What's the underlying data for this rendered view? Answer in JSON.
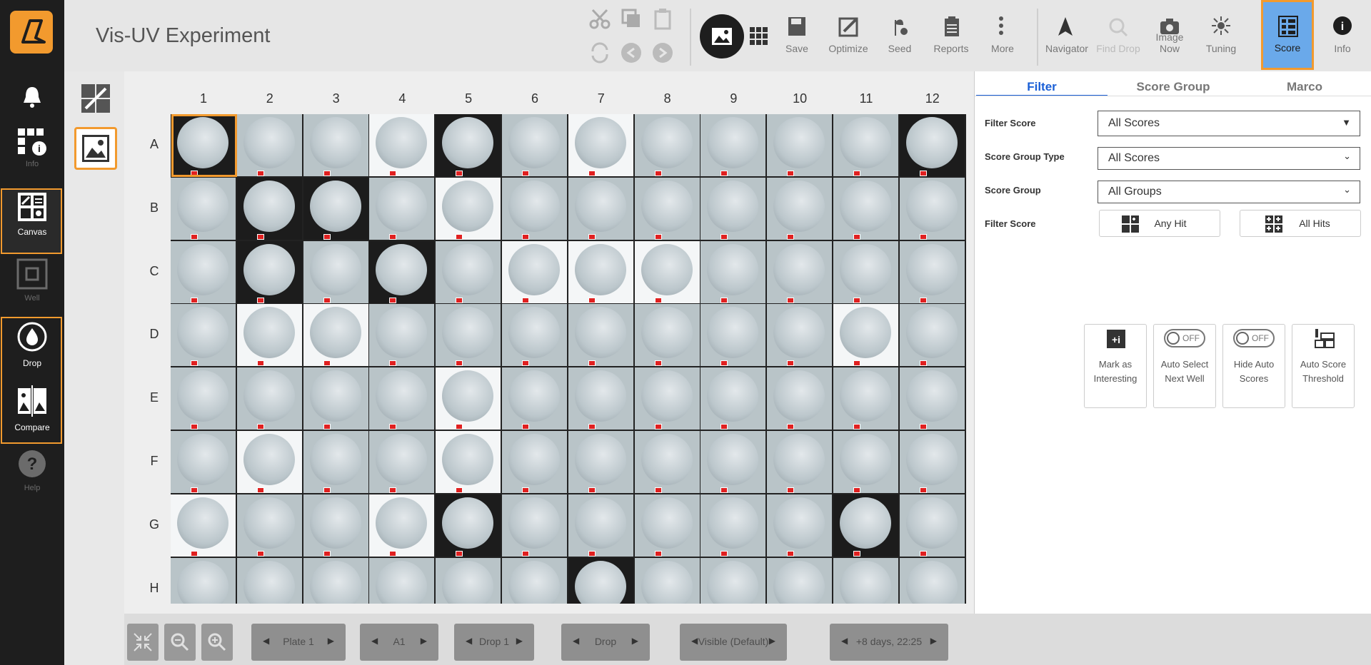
{
  "app": {
    "title": "Vis-UV Experiment"
  },
  "rail": {
    "items": [
      {
        "label": "Info",
        "dim": true
      },
      {
        "label": "Canvas",
        "dim": false
      },
      {
        "label": "Well",
        "dim": true
      },
      {
        "label": "Drop",
        "dim": false
      },
      {
        "label": "Compare",
        "dim": false
      },
      {
        "label": "Help",
        "dim": true
      }
    ]
  },
  "toolbar": {
    "save": "Save",
    "optimize": "Optimize",
    "seed": "Seed",
    "reports": "Reports",
    "more": "More",
    "navigator": "Navigator",
    "find_drop": "Find Drop",
    "image_now": "Image Now",
    "tuning": "Tuning",
    "score": "Score",
    "info": "Info"
  },
  "grid": {
    "columns": [
      "1",
      "2",
      "3",
      "4",
      "5",
      "6",
      "7",
      "8",
      "9",
      "10",
      "11",
      "12"
    ],
    "rows": [
      "A",
      "B",
      "C",
      "D",
      "E",
      "F",
      "G",
      "H"
    ]
  },
  "panel": {
    "tabs": [
      "Filter",
      "Score Group",
      "Marco"
    ],
    "filter_score_label": "Filter Score",
    "filter_score_value": "All Scores",
    "score_group_type_label": "Score Group Type",
    "score_group_type_value": "All Scores",
    "score_group_label": "Score Group",
    "score_group_value": "All Groups",
    "filter_score2_label": "Filter Score",
    "any_hit": "Any Hit",
    "all_hits": "All Hits",
    "cards": {
      "mark_interesting": "Mark as Interesting",
      "auto_select": "Auto Select Next Well",
      "hide_auto": "Hide Auto Scores",
      "auto_threshold": "Auto Score Threshold",
      "off": "OFF"
    }
  },
  "bottom": {
    "plate": "Plate 1",
    "well": "A1",
    "drop_num": "Drop 1",
    "drop": "Drop",
    "visible": "Visible (Default)",
    "time": "+8 days, 22:25"
  },
  "colors": {
    "accent": "#f29a2e",
    "active_tab": "#1a5fd6",
    "score_bg": "#6aa9ea"
  }
}
